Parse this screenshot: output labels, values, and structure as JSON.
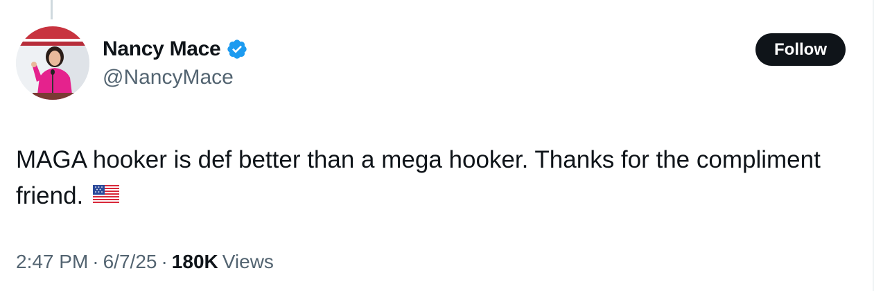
{
  "author": {
    "display_name": "Nancy Mace",
    "handle": "@NancyMace",
    "verified": true,
    "avatar": "profile-photo-icon"
  },
  "follow_button": {
    "label": "Follow"
  },
  "tweet": {
    "text": "MAGA hooker is def better than a mega hooker. Thanks for the compliment friend.",
    "emoji": "us-flag-icon"
  },
  "meta": {
    "time": "2:47 PM",
    "separator": "·",
    "date": "6/7/25",
    "views_count": "180K",
    "views_label": "Views"
  },
  "colors": {
    "text_primary": "#0f1419",
    "text_secondary": "#536471",
    "verified_blue": "#1d9bf0",
    "follow_bg": "#0f1419"
  }
}
